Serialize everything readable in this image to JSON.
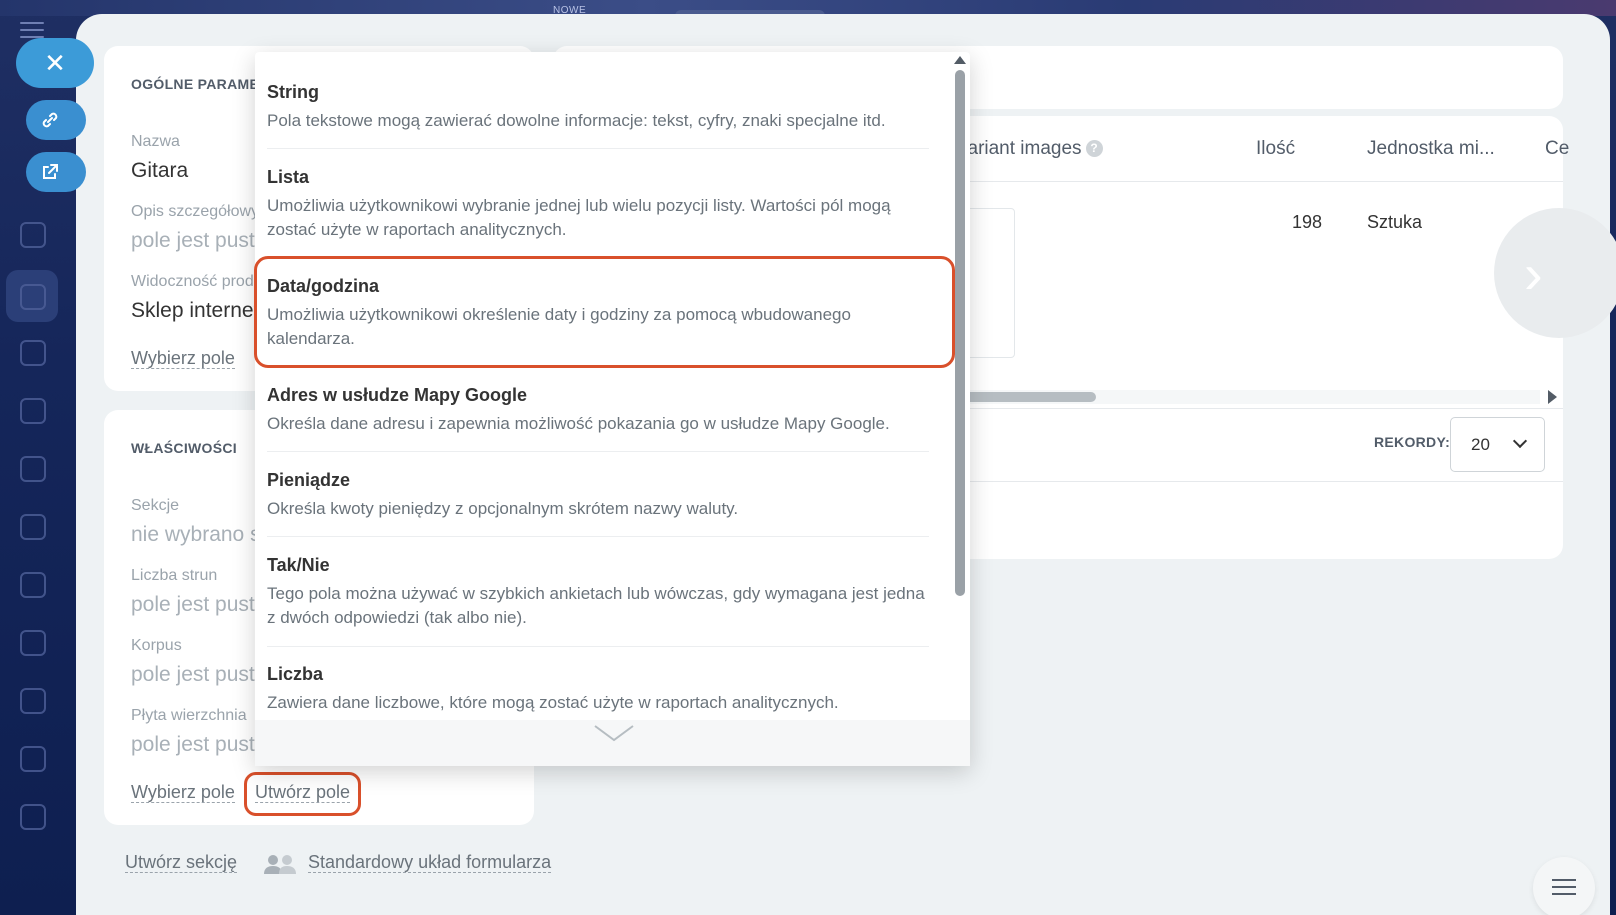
{
  "top": {
    "badge": "NOWE"
  },
  "panel": {
    "general": {
      "title": "OGÓLNE PARAME",
      "fields": [
        {
          "label": "Nazwa",
          "value": "Gitara"
        },
        {
          "label": "Opis szczegółowy",
          "value": "pole jest pust"
        },
        {
          "label": "Widoczność prod",
          "value": "Sklep internet"
        }
      ],
      "select_link": "Wybierz pole"
    },
    "properties": {
      "title": "WŁAŚCIWOŚCI",
      "fields": [
        {
          "label": "Sekcje",
          "value": "nie wybrano s"
        },
        {
          "label": "Liczba strun",
          "value": "pole jest pust"
        },
        {
          "label": "Korpus",
          "value": "pole jest pust"
        },
        {
          "label": "Płyta wierzchnia",
          "value": "pole jest pust"
        }
      ],
      "select_link": "Wybierz pole",
      "create_link": "Utwórz pole"
    },
    "table": {
      "headers": [
        "variant images",
        "Ilość",
        "Jednostka mi...",
        "Ce"
      ],
      "row": {
        "qty": "198",
        "unit": "Sztuka"
      },
      "records_label": "REKORDY:",
      "records_value": "20"
    },
    "bottom": {
      "create_section": "Utwórz sekcję",
      "standard_layout": "Standardowy układ formularza"
    }
  },
  "dropdown": {
    "items": [
      {
        "title": "String",
        "desc": "Pola tekstowe mogą zawierać dowolne informacje: tekst, cyfry, znaki specjalne itd."
      },
      {
        "title": "Lista",
        "desc": "Umożliwia użytkownikowi wybranie jednej lub wielu pozycji listy. Wartości pól mogą zostać użyte w raportach analitycznych."
      },
      {
        "title": "Data/godzina",
        "desc": "Umożliwia użytkownikowi określenie daty i godziny za pomocą wbudowanego kalendarza."
      },
      {
        "title": "Adres w usłudze Mapy Google",
        "desc": "Określa dane adresu i zapewnia możliwość pokazania go w usłudze Mapy Google."
      },
      {
        "title": "Pieniądze",
        "desc": "Określa kwoty pieniędzy z opcjonalnym skrótem nazwy waluty."
      },
      {
        "title": "Tak/Nie",
        "desc": "Tego pola można używać w szybkich ankietach lub wówczas, gdy wymagana jest jedna z dwóch odpowiedzi (tak albo nie)."
      },
      {
        "title": "Liczba",
        "desc": "Zawiera dane liczbowe, które mogą zostać użyte w raportach analitycznych."
      }
    ]
  },
  "colors": {
    "highlight": "#d9502b",
    "accent": "#3c9bd8"
  }
}
